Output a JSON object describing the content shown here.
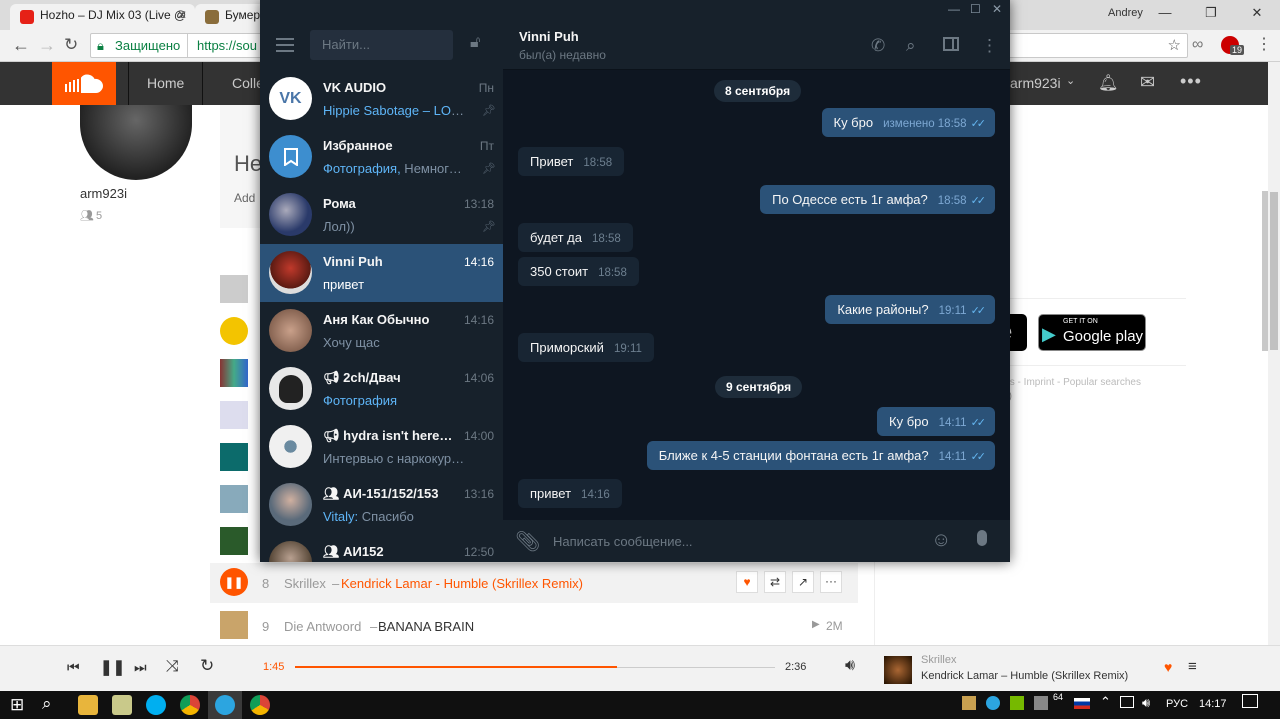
{
  "browser": {
    "tabs": [
      {
        "title": "Hozho – DJ Mix 03 (Live @",
        "color": "#e62117"
      },
      {
        "title": "Бумер –",
        "color": "#8a6d3b"
      }
    ],
    "profile_name": "Andrey",
    "secure_label": "Защищено",
    "url": "https://sou",
    "ext_badge": "19"
  },
  "soundcloud": {
    "nav": [
      "Home",
      "Colle"
    ],
    "username_header": "arm923i",
    "profile_name": "arm923i",
    "followers": "5",
    "heading_partial": "He",
    "add_partial": "Add",
    "store_badges": {
      "apple_partial": "e",
      "google_small": "GET IT ON",
      "google_big": "Google play"
    },
    "footer_links": "ies - Imprint - Popular searches",
    "footer_partial": "S)",
    "tracks": [
      {
        "num": "8",
        "artist": "Skrillex",
        "title": "Kendrick Lamar - Humble (Skrillex Remix)",
        "playing": true
      },
      {
        "num": "9",
        "artist": "Die Antwoord",
        "title": "BANANA BRAIN",
        "plays": "2M",
        "playing": false
      }
    ]
  },
  "player": {
    "elapsed": "1:45",
    "duration": "2:36",
    "progress": 0.67,
    "artist": "Skrillex",
    "title": "Kendrick Lamar – Humble (Skrillex Remix)"
  },
  "telegram": {
    "search_placeholder": "Найти...",
    "chats": [
      {
        "name": "VK AUDIO",
        "time": "Пн",
        "preview_hl": "Hippie Sabotage – LOVE...",
        "preview": "",
        "pinned": true,
        "avatar_color": "#fff"
      },
      {
        "name": "Избранное",
        "time": "Пт",
        "preview_hl": "Фотография,",
        "preview": " Немного ...",
        "pinned": true,
        "avatar_color": "#3d8ecf"
      },
      {
        "name": "Рома",
        "time": "13:18",
        "preview_hl": "",
        "preview": "Лол))",
        "pinned": true,
        "avatar_color": "#2a3a6a"
      },
      {
        "name": "Vinni Puh",
        "time": "14:16",
        "preview_hl": "",
        "preview": "привет",
        "pinned": false,
        "avatar_color": "#c0392b"
      },
      {
        "name": "Аня Как Обычно",
        "time": "14:16",
        "preview_hl": "",
        "preview": "Хочу щас",
        "pinned": false,
        "avatar_color": "#a67c6a"
      },
      {
        "name": "2ch/Двач",
        "time": "14:06",
        "preview_hl": "Фотография",
        "preview": "",
        "pinned": false,
        "avatar_color": "#e8e8e8",
        "channel": true
      },
      {
        "name": "hydra isn't here b...",
        "time": "14:00",
        "preview_hl": "",
        "preview": "Интервью с наркокурьеро...",
        "pinned": false,
        "avatar_color": "#f0f0f0",
        "channel": true
      },
      {
        "name": "АИ-151/152/153",
        "time": "13:16",
        "preview_hl": "Vitaly:",
        "preview": " Спасибо",
        "pinned": false,
        "avatar_color": "#7a8a99",
        "group": true
      },
      {
        "name": "АИ152",
        "time": "12:50",
        "preview_hl": "",
        "preview": "",
        "pinned": false,
        "avatar_color": "#8a7a6a",
        "group": true
      }
    ],
    "active_chat": {
      "name": "Vinni Puh",
      "status": "был(а) недавно"
    },
    "dates": [
      "8 сентября",
      "9 сентября"
    ],
    "messages": [
      {
        "dir": "out",
        "text": "Ку бро",
        "time": "изменено 18:58"
      },
      {
        "dir": "in",
        "text": "Привет",
        "time": "18:58"
      },
      {
        "dir": "out",
        "text": "По Одессе есть 1г амфа?",
        "time": "18:58"
      },
      {
        "dir": "in",
        "text": "будет да",
        "time": "18:58"
      },
      {
        "dir": "in",
        "text": "350 стоит",
        "time": "18:58"
      },
      {
        "dir": "out",
        "text": "Какие районы?",
        "time": "19:11"
      },
      {
        "dir": "in",
        "text": "Приморский",
        "time": "19:11"
      },
      {
        "dir": "out",
        "text": "Ку бро",
        "time": "14:11"
      },
      {
        "dir": "out",
        "text": "Ближе к 4-5 станции фонтана есть 1г амфа?",
        "time": "14:11"
      },
      {
        "dir": "in",
        "text": "привет",
        "time": "14:16"
      }
    ],
    "compose_placeholder": "Написать сообщение..."
  },
  "taskbar": {
    "lang": "РУС",
    "clock": "14:17",
    "tray_num": "64"
  }
}
